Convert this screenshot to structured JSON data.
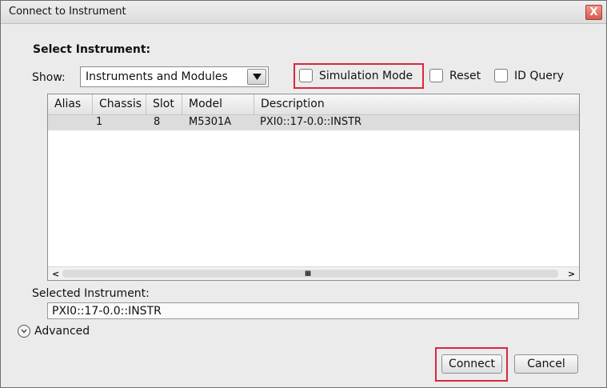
{
  "window": {
    "title": "Connect to Instrument",
    "close_glyph": "X"
  },
  "select_instrument": {
    "heading": "Select Instrument:",
    "show_label": "Show:",
    "show_value": "Instruments and Modules",
    "options": {
      "simulation_mode": {
        "label": "Simulation Mode",
        "checked": false,
        "highlighted": true
      },
      "reset": {
        "label": "Reset",
        "checked": false
      },
      "id_query": {
        "label": "ID Query",
        "checked": false
      }
    }
  },
  "table": {
    "columns": [
      "Alias",
      "Chassis",
      "Slot",
      "Model",
      "Description"
    ],
    "rows": [
      {
        "alias": "",
        "chassis": "1",
        "slot": "8",
        "model": "M5301A",
        "description": "PXI0::17-0.0::INSTR"
      }
    ],
    "scroll_left_glyph": "<",
    "scroll_right_glyph": ">",
    "scroll_grip_glyph": "III"
  },
  "selected_instrument": {
    "label": "Selected Instrument:",
    "value": "PXI0::17-0.0::INSTR"
  },
  "advanced": {
    "label": "Advanced",
    "icon": "chevron-down-circle-icon"
  },
  "buttons": {
    "connect": "Connect",
    "cancel": "Cancel"
  },
  "colors": {
    "highlight": "#d6283d",
    "close_button": "#d35a4f",
    "dialog_bg": "#ebebeb"
  }
}
